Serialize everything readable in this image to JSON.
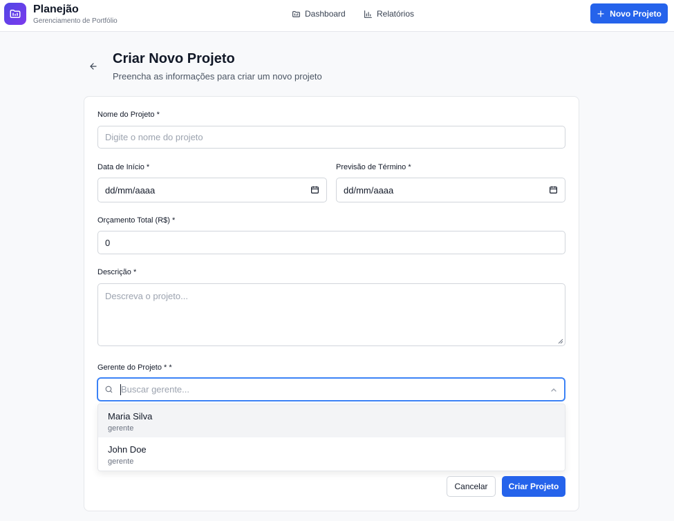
{
  "app": {
    "title": "Planejão",
    "subtitle": "Gerenciamento de Portfólio"
  },
  "nav": {
    "dashboard": {
      "label": "Dashboard",
      "icon": "dashboard-icon"
    },
    "reports": {
      "label": "Relatórios",
      "icon": "bar-chart-icon"
    },
    "new_project": {
      "label": "Novo Projeto",
      "icon": "plus-icon"
    }
  },
  "page": {
    "title": "Criar Novo Projeto",
    "subtitle": "Preencha as informações para criar um novo projeto"
  },
  "form": {
    "name": {
      "label": "Nome do Projeto *",
      "placeholder": "Digite o nome do projeto"
    },
    "start_date": {
      "label": "Data de Início *",
      "value": "dd/mm/aaaa"
    },
    "end_date": {
      "label": "Previsão de Término *",
      "value": "dd/mm/aaaa"
    },
    "budget": {
      "label": "Orçamento Total (R$) *",
      "value": "0"
    },
    "description": {
      "label": "Descrição *",
      "placeholder": "Descreva o projeto..."
    },
    "manager": {
      "label": "Gerente do Projeto * *",
      "placeholder": "Buscar gerente...",
      "options": [
        {
          "name": "Maria Silva",
          "role": "gerente"
        },
        {
          "name": "John Doe",
          "role": "gerente"
        }
      ]
    },
    "cancel_label": "Cancelar",
    "submit_label": "Criar Projeto"
  },
  "colors": {
    "primary": "#2563eb",
    "focus": "#3b82f6",
    "logo_gradient": [
      "#4f46e5",
      "#7c3aed"
    ]
  }
}
